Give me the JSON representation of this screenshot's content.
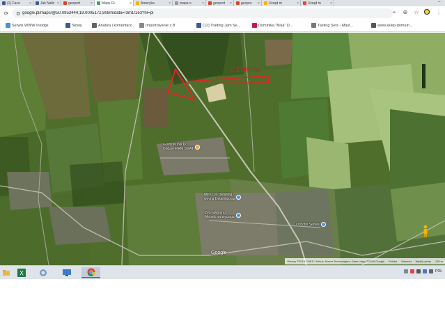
{
  "browser": {
    "tabs": [
      {
        "label": "(1) Face",
        "favicon_color": "#3b5998",
        "active": false
      },
      {
        "label": "Jak Nalic",
        "favicon_color": "#3b5998",
        "active": false
      },
      {
        "label": "geoport",
        "favicon_color": "#d7422b",
        "active": false
      },
      {
        "label": "Mapy Gi",
        "favicon_color": "#34a853",
        "active": true
      },
      {
        "label": "Ameryka",
        "favicon_color": "#f4b400",
        "active": false
      },
      {
        "label": "mapa o",
        "favicon_color": "#999999",
        "active": false
      },
      {
        "label": "geoport",
        "favicon_color": "#d7422b",
        "active": false
      },
      {
        "label": "geopor",
        "favicon_color": "#d7422b",
        "active": false
      },
      {
        "label": "Urząd m",
        "favicon_color": "#f4b400",
        "active": false
      },
      {
        "label": "Urząd m",
        "favicon_color": "#e8453c",
        "active": false
      }
    ],
    "minimize_glyph": "–",
    "url": "google.pl/maps/@50.0953444,19.0005172,808m/data=!3m1!1e3?hl=pl",
    "bookmarks": [
      {
        "label": "Serwis WWW Insidgs",
        "favicon_color": "#4a90d9"
      },
      {
        "label": "Słowy",
        "favicon_color": "#3b5998"
      },
      {
        "label": "Analiza i komentarz...",
        "favicon_color": "#5f6368"
      },
      {
        "label": "Importowanie z B",
        "favicon_color": "#888888"
      },
      {
        "label": "(12) Trading Jam Se...",
        "favicon_color": "#3b5998"
      },
      {
        "label": "Dominika \"Nika\" D...",
        "favicon_color": "#c2185b"
      },
      {
        "label": "Tasting Sets - Mast...",
        "favicon_color": "#777777"
      },
      {
        "label": "www.sklep-domeln...",
        "favicon_color": "#555555"
      }
    ]
  },
  "map": {
    "area_label": "0,2701 ha",
    "annotation_color": "#e32323",
    "logo_text": "Google",
    "pois": [
      {
        "label": "Grafix Kubki Do\nDodaw FIRM SMAT",
        "color": "#f29d38"
      },
      {
        "label": "Milly Car Detailing\nwoyna Detailingowa",
        "color": "#4a90d9"
      },
      {
        "label": "Zydrajwoping\nMebelz na wyciągu",
        "color": "#4a90d9"
      },
      {
        "label": "Ochotni Serwis",
        "color": "#4a90d9"
      }
    ],
    "attribution": [
      "Obrazy ©2019 CNES / Airbus, Maxar Technologies, Dane mapy ©2019 Google",
      "Polska",
      "Warunki",
      "Wyślij opinię",
      "100 m"
    ]
  },
  "taskbar": {
    "apps": [
      {
        "name": "windows-explorer",
        "active": false
      },
      {
        "name": "excel",
        "active": false
      },
      {
        "name": "internet-explorer",
        "active": false
      },
      {
        "name": "desktop-manager",
        "active": false
      },
      {
        "name": "chrome",
        "active": true
      }
    ],
    "language": "POL"
  }
}
